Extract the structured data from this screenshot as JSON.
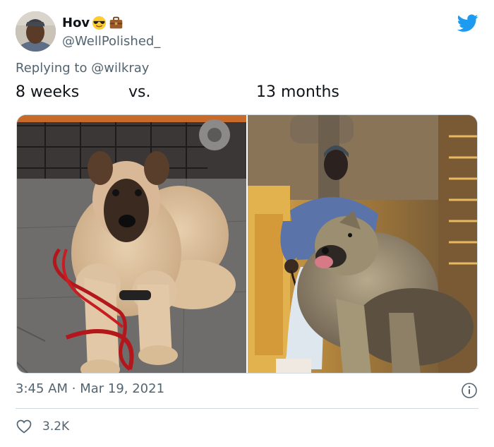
{
  "author": {
    "name": "Hov",
    "name_emojis": [
      "sunglasses-face-emoji",
      "briefcase-emoji"
    ],
    "handle": "@WellPolished_"
  },
  "reply": {
    "prefix": "Replying to",
    "mention": "@wilkray"
  },
  "tweet": {
    "text_left": "8 weeks",
    "text_mid": "vs.",
    "text_right": "13 months"
  },
  "media": {
    "photos": [
      {
        "description_icon": "puppy-photo"
      },
      {
        "description_icon": "grown-dog-photo"
      }
    ]
  },
  "meta": {
    "time": "3:45 AM",
    "separator": "·",
    "date": "Mar 19, 2021"
  },
  "engagement": {
    "likes": "3.2K"
  },
  "colors": {
    "twitter_blue": "#1d9bf0",
    "secondary_text": "#536471",
    "divider": "#cfd9de"
  }
}
